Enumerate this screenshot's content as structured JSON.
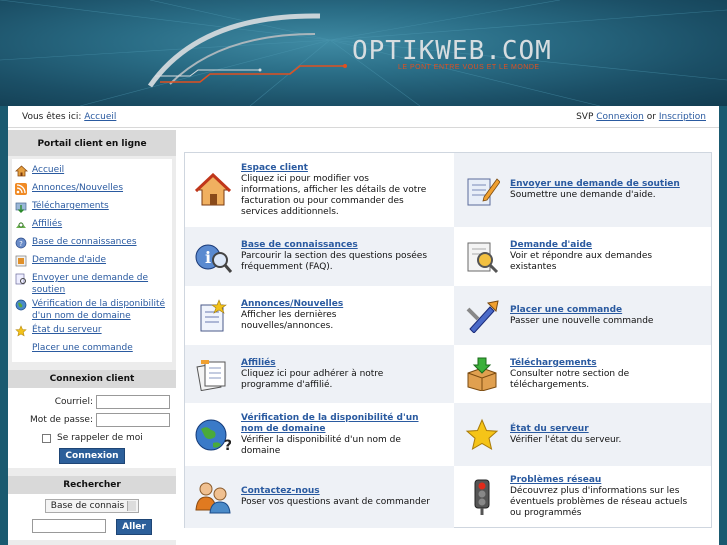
{
  "header": {
    "logo_text": "OPTIKWEB.COM",
    "logo_tagline": "LE PONT ENTRE VOUS ET LE MONDE"
  },
  "topbar": {
    "location_prefix": "Vous êtes ici:",
    "location_link": "Accueil",
    "svp": "SVP",
    "login_link": "Connexion",
    "or": "or",
    "register_link": "Inscription"
  },
  "sidebar": {
    "portal_title": "Portail client en ligne",
    "menu": [
      {
        "label": "Accueil",
        "icon": "home-icon"
      },
      {
        "label": "Annonces/Nouvelles",
        "icon": "rss-icon"
      },
      {
        "label": "Téléchargements",
        "icon": "download-icon"
      },
      {
        "label": "Affiliés",
        "icon": "affiliate-icon"
      },
      {
        "label": "Base de connaissances",
        "icon": "knowledgebase-icon"
      },
      {
        "label": "Demande d'aide",
        "icon": "support-icon"
      },
      {
        "label": "Envoyer une demande de soutien",
        "icon": "ticket-icon"
      },
      {
        "label": "Vérification de la disponibilité d'un nom de domaine",
        "icon": "globe-icon"
      },
      {
        "label": "État du serveur",
        "icon": "star-icon"
      },
      {
        "label": "Placer une commande",
        "icon": "order-icon"
      }
    ],
    "login": {
      "title": "Connexion client",
      "email_label": "Courriel:",
      "password_label": "Mot de passe:",
      "remember_label": "Se rappeler de moi",
      "submit": "Connexion"
    },
    "search": {
      "title": "Rechercher",
      "select_value": "Base de connais",
      "button": "Aller"
    }
  },
  "grid": [
    {
      "title": "Espace client",
      "desc": "Cliquez ici pour modifier vos informations, afficher les détails de votre facturation ou pour commander des services additionnels.",
      "icon": "house-icon"
    },
    {
      "title": "Envoyer une demande de soutien",
      "desc": "Soumettre une demande d'aide.",
      "icon": "notepad-pencil-icon"
    },
    {
      "title": "Base de connaissances",
      "desc": "Parcourir la section des questions posées fréquemment (FAQ).",
      "icon": "info-magnifier-icon"
    },
    {
      "title": "Demande d'aide",
      "desc": "Voir et répondre aux demandes existantes",
      "icon": "document-search-icon"
    },
    {
      "title": "Annonces/Nouvelles",
      "desc": "Afficher les dernières nouvelles/annonces.",
      "icon": "news-icon"
    },
    {
      "title": "Placer une commande",
      "desc": "Passer une nouvelle commande",
      "icon": "tools-icon"
    },
    {
      "title": "Affiliés",
      "desc": "Cliquez ici pour adhérer à notre programme d'affilié.",
      "icon": "papers-icon"
    },
    {
      "title": "Téléchargements",
      "desc": "Consulter notre section de téléchargements.",
      "icon": "box-download-icon"
    },
    {
      "title": "Vérification de la disponibilité d'un nom de domaine",
      "desc": "Vérifier la disponibilité d'un nom de domaine",
      "icon": "globe-question-icon"
    },
    {
      "title": "État du serveur",
      "desc": "Vérifier l'état du serveur.",
      "icon": "star-icon"
    },
    {
      "title": "Contactez-nous",
      "desc": "Poser vos questions avant de commander",
      "icon": "people-icon"
    },
    {
      "title": "Problèmes réseau",
      "desc": "Découvrez plus d'informations sur les éventuels problèmes de réseau actuels ou programmés",
      "icon": "traffic-light-icon"
    }
  ]
}
